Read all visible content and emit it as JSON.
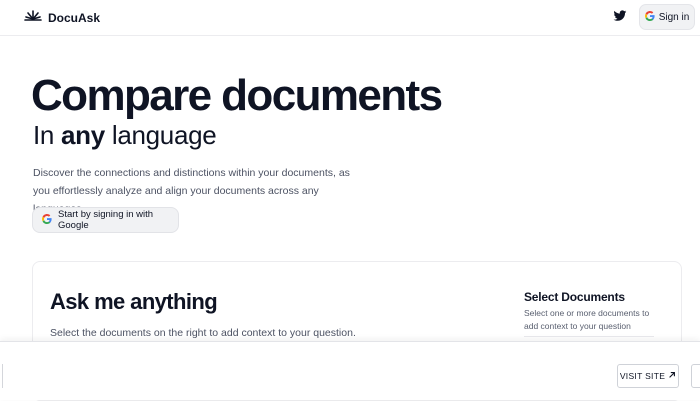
{
  "header": {
    "brand_name": "DocuAsk",
    "sign_in_label": "Sign in"
  },
  "hero": {
    "title": "Compare documents",
    "subtitle_prefix": "In ",
    "subtitle_emphasis": "any",
    "subtitle_suffix": " language",
    "description": "Discover the connections and distinctions within your documents, as you effortlessly analyze and align your documents across any languages.",
    "google_button_label": "Start by signing in with Google"
  },
  "chat": {
    "title": "Ask me anything",
    "description": "Select the documents on the right to add context to your question."
  },
  "documents_panel": {
    "title": "Select Documents",
    "description": "Select one or more documents to add context to your question"
  },
  "bottom_bar": {
    "visit_site_label": "VISIT SITE"
  },
  "icons": {
    "brand": "sunrise-logo-icon",
    "twitter": "twitter-icon",
    "google": "google-g-icon",
    "external": "arrow-up-right-icon"
  },
  "colors": {
    "text": "#0f1424",
    "muted": "#4c5263",
    "button_bg": "#f1f2f4"
  }
}
